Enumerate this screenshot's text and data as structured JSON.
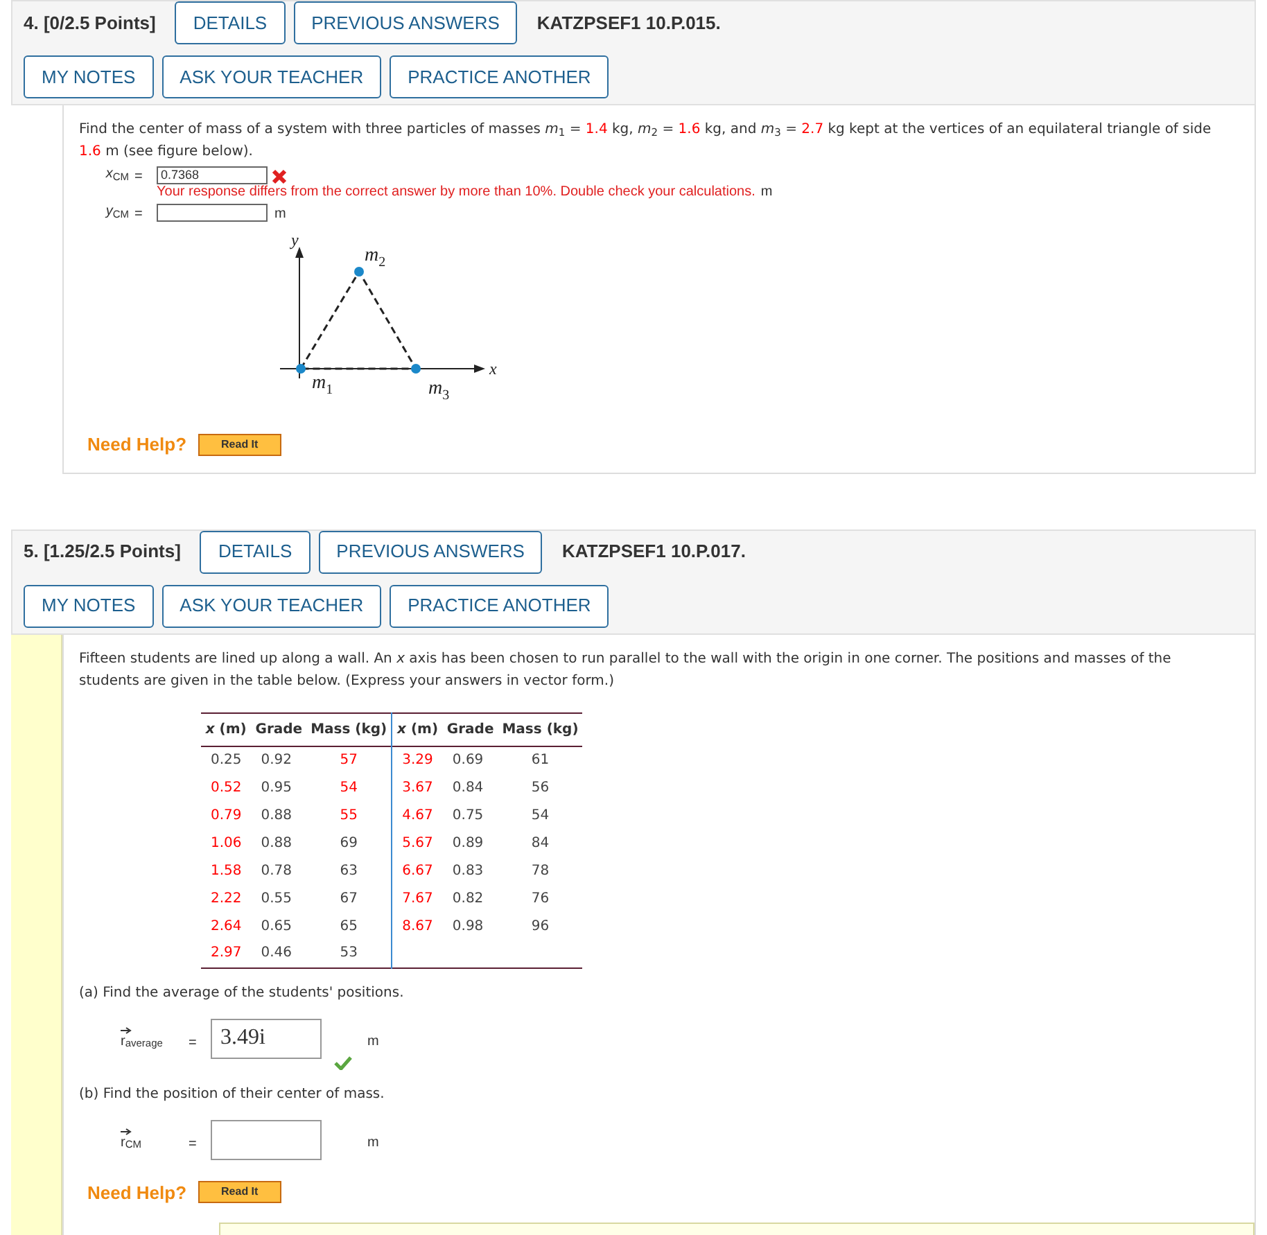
{
  "problems": [
    {
      "number": "4.",
      "points": "[0/2.5 Points]",
      "buttons_row1": [
        "DETAILS",
        "PREVIOUS ANSWERS"
      ],
      "code": "KATZPSEF1 10.P.015.",
      "buttons_row2": [
        "MY NOTES",
        "ASK YOUR TEACHER",
        "PRACTICE ANOTHER"
      ],
      "side_strip": false,
      "blocks": [
        {
          "kind": "text",
          "parts": [
            {
              "kind": "text",
              "t": "Find the center of mass of a system with three particles of masses "
            },
            {
              "kind": "text",
              "t": "*m*$_{1}$ = "
            },
            {
              "kind": "value",
              "t": "1.4"
            },
            {
              "kind": "text",
              "t": " kg,  *m*$_{2}$ = "
            },
            {
              "kind": "value",
              "t": "1.6"
            },
            {
              "kind": "text",
              "t": " kg,  and  *m*$_{3}$ = "
            },
            {
              "kind": "value",
              "t": "2.7"
            },
            {
              "kind": "text",
              "t": " kg  kept at the vertices of an equilateral triangle of side "
            },
            {
              "kind": "value",
              "t": "1.6"
            },
            {
              "kind": "text",
              "t": " m (see figure below)."
            }
          ]
        },
        {
          "kind": "answer",
          "label": "*x*$_{CM}$",
          "equals": "=",
          "value": "0.7368",
          "correct": false,
          "message": "Your response differs from the correct answer by more than 10%. Double check your calculations.",
          "unit": "m",
          "vector": false
        },
        {
          "kind": "answer",
          "label": "*y*$_{CM}$",
          "equals": "=",
          "unit": "m",
          "vector": false
        },
        {
          "kind": "figure",
          "y_axis": "y",
          "x_axis": "x",
          "labels": [
            {
              "t": "m",
              "sub": "2"
            },
            {
              "t": "m",
              "sub": "1"
            },
            {
              "t": "m",
              "sub": "3"
            }
          ]
        },
        {
          "kind": "help",
          "label": "Need Help?",
          "button": "Read It"
        }
      ]
    },
    {
      "number": "5.",
      "points": "[1.25/2.5 Points]",
      "buttons_row1": [
        "DETAILS",
        "PREVIOUS ANSWERS"
      ],
      "code": "KATZPSEF1 10.P.017.",
      "buttons_row2": [
        "MY NOTES",
        "ASK YOUR TEACHER",
        "PRACTICE ANOTHER"
      ],
      "side_strip": true,
      "blocks": [
        {
          "kind": "text",
          "parts": [
            {
              "kind": "text",
              "t": "Fifteen students are lined up along a wall. An *x* axis has been chosen to run parallel to the wall with the origin in one corner. The positions and masses of the students are given in the table below. (Express your answers in vector form.)"
            }
          ]
        },
        {
          "kind": "table",
          "columns": [
            "*x* (m)",
            "Grade",
            "Mass (kg)",
            "*x* (m)",
            "Grade",
            "Mass (kg)"
          ],
          "rows": [
            {
              "cells": [
                {
                  "t": "0.25",
                  "highlighted": false
                },
                {
                  "t": "0.92",
                  "highlighted": false
                },
                {
                  "t": "57",
                  "highlighted": true
                },
                {
                  "t": "3.29",
                  "highlighted": true
                },
                {
                  "t": "0.69",
                  "highlighted": false
                },
                {
                  "t": "61",
                  "highlighted": false
                }
              ]
            },
            {
              "cells": [
                {
                  "t": "0.52",
                  "highlighted": true
                },
                {
                  "t": "0.95",
                  "highlighted": false
                },
                {
                  "t": "54",
                  "highlighted": true
                },
                {
                  "t": "3.67",
                  "highlighted": true
                },
                {
                  "t": "0.84",
                  "highlighted": false
                },
                {
                  "t": "56",
                  "highlighted": false
                }
              ]
            },
            {
              "cells": [
                {
                  "t": "0.79",
                  "highlighted": true
                },
                {
                  "t": "0.88",
                  "highlighted": false
                },
                {
                  "t": "55",
                  "highlighted": true
                },
                {
                  "t": "4.67",
                  "highlighted": true
                },
                {
                  "t": "0.75",
                  "highlighted": false
                },
                {
                  "t": "54",
                  "highlighted": false
                }
              ]
            },
            {
              "cells": [
                {
                  "t": "1.06",
                  "highlighted": true
                },
                {
                  "t": "0.88",
                  "highlighted": false
                },
                {
                  "t": "69",
                  "highlighted": false
                },
                {
                  "t": "5.67",
                  "highlighted": true
                },
                {
                  "t": "0.89",
                  "highlighted": false
                },
                {
                  "t": "84",
                  "highlighted": false
                }
              ]
            },
            {
              "cells": [
                {
                  "t": "1.58",
                  "highlighted": true
                },
                {
                  "t": "0.78",
                  "highlighted": false
                },
                {
                  "t": "63",
                  "highlighted": false
                },
                {
                  "t": "6.67",
                  "highlighted": true
                },
                {
                  "t": "0.83",
                  "highlighted": false
                },
                {
                  "t": "78",
                  "highlighted": false
                }
              ]
            },
            {
              "cells": [
                {
                  "t": "2.22",
                  "highlighted": true
                },
                {
                  "t": "0.55",
                  "highlighted": false
                },
                {
                  "t": "67",
                  "highlighted": false
                },
                {
                  "t": "7.67",
                  "highlighted": true
                },
                {
                  "t": "0.82",
                  "highlighted": false
                },
                {
                  "t": "76",
                  "highlighted": false
                }
              ]
            },
            {
              "cells": [
                {
                  "t": "2.64",
                  "highlighted": true
                },
                {
                  "t": "0.65",
                  "highlighted": false
                },
                {
                  "t": "65",
                  "highlighted": false
                },
                {
                  "t": "8.67",
                  "highlighted": true
                },
                {
                  "t": "0.98",
                  "highlighted": false
                },
                {
                  "t": "96",
                  "highlighted": false
                }
              ]
            },
            {
              "cells": [
                {
                  "t": "2.97",
                  "highlighted": true
                },
                {
                  "t": "0.46",
                  "highlighted": false
                },
                {
                  "t": "53",
                  "highlighted": false
                }
              ]
            }
          ]
        },
        {
          "kind": "text",
          "parts": [
            {
              "kind": "text",
              "t": "(a) Find the average of the students' positions."
            }
          ]
        },
        {
          "kind": "answer",
          "label": "r$_{average}$",
          "equals": "=",
          "value": "3.49i",
          "correct": true,
          "unit": "m",
          "vector": true
        },
        {
          "kind": "text",
          "parts": [
            {
              "kind": "text",
              "t": "(b) Find the position of their center of mass."
            }
          ]
        },
        {
          "kind": "answer",
          "label": "r$_{CM}$",
          "equals": "=",
          "unit": "m",
          "vector": true
        },
        {
          "kind": "help",
          "label": "Need Help?",
          "button": "Read It"
        },
        {
          "kind": "panel"
        }
      ]
    }
  ]
}
